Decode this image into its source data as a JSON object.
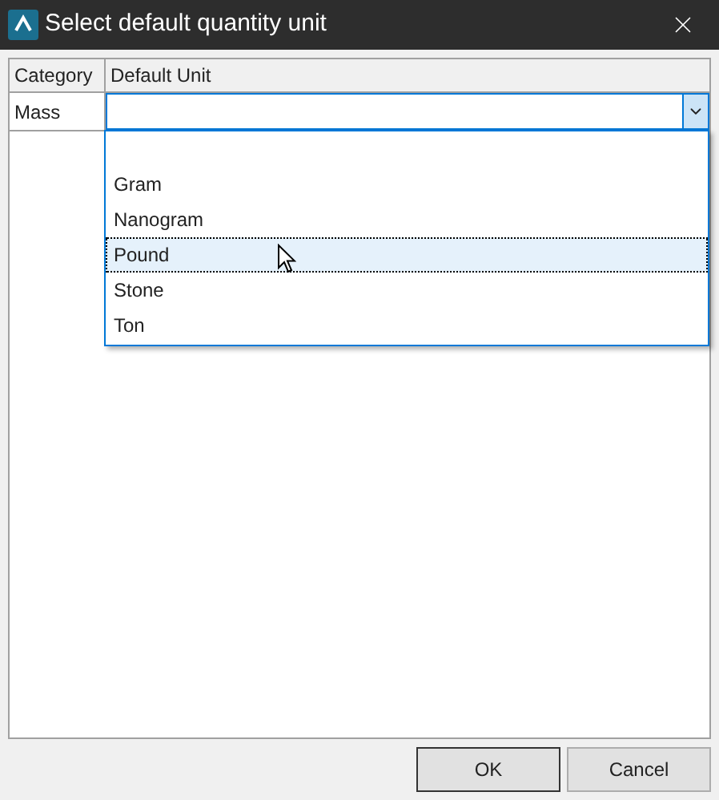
{
  "window": {
    "title": "Select default quantity unit"
  },
  "table": {
    "columns": [
      "Category",
      "Default Unit"
    ],
    "rows": [
      {
        "category": "Mass",
        "dropdown": {
          "expanded": true,
          "options": [
            {
              "label": "Gram",
              "selected": false
            },
            {
              "label": "Nanogram",
              "selected": false
            },
            {
              "label": "Pound",
              "selected": true
            },
            {
              "label": "Stone",
              "selected": false
            },
            {
              "label": "Ton",
              "selected": false
            }
          ]
        }
      }
    ]
  },
  "buttons": [
    {
      "label": "OK",
      "default": true
    },
    {
      "label": "Cancel",
      "default": false
    }
  ]
}
